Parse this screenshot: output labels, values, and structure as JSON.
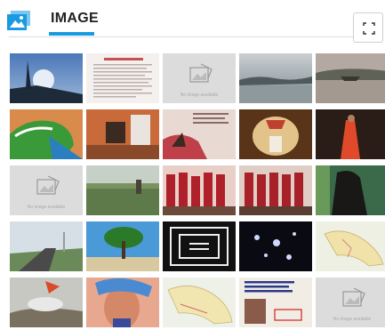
{
  "header": {
    "title": "IMAGE",
    "app_icon": "image-gallery-icon",
    "fullscreen_icon": "fullscreen-icon"
  },
  "colors": {
    "accent": "#1a9ae0",
    "placeholder_bg": "#dcdcdc"
  },
  "grid": {
    "rows": 5,
    "cols": 5,
    "placeholder_label": "No image available"
  }
}
